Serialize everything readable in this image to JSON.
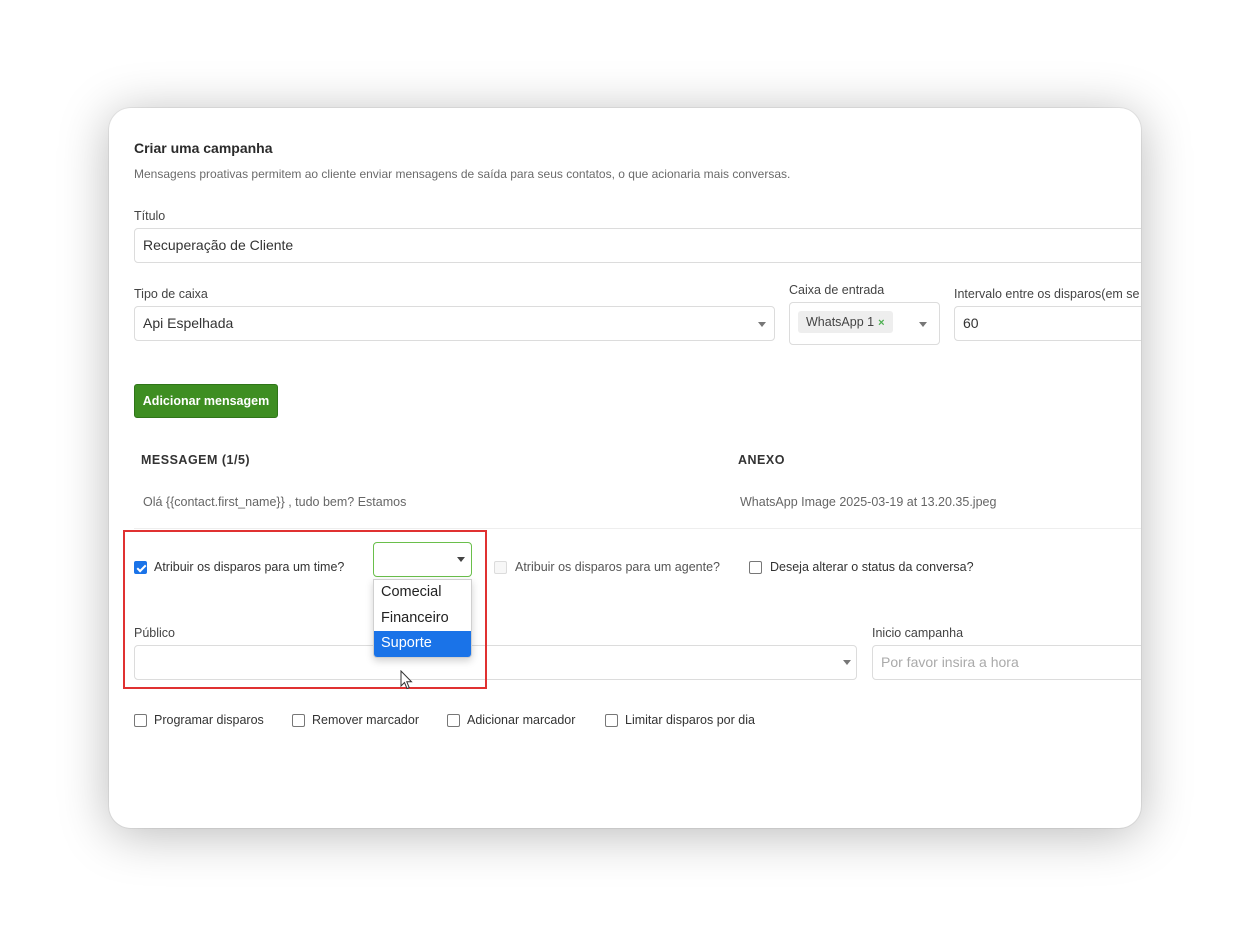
{
  "header": {
    "title": "Criar uma campanha",
    "subtitle": "Mensagens proativas permitem ao cliente enviar mensagens de saída para seus contatos, o que acionaria mais conversas."
  },
  "form": {
    "titulo": {
      "label": "Título",
      "value": "Recuperação de Cliente"
    },
    "tipo_caixa": {
      "label": "Tipo de caixa",
      "value": "Api Espelhada"
    },
    "caixa_entrada": {
      "label": "Caixa de entrada",
      "chip": "WhatsApp 1",
      "chip_remove": "×"
    },
    "intervalo": {
      "label": "Intervalo entre os disparos(em se",
      "value": "60"
    },
    "add_message_button": "Adicionar mensagem"
  },
  "messages_table": {
    "col_message": "MESSAGEM (1/5)",
    "col_attachment": "ANEXO",
    "rows": [
      {
        "message": "Olá {{contact.first_name}} , tudo bem? Estamos",
        "attachment": "WhatsApp Image 2025-03-19 at 13.20.35.jpeg"
      }
    ]
  },
  "assign": {
    "team_checkbox": {
      "label": "Atribuir os disparos para um time?",
      "checked": true
    },
    "team_select": {
      "value": "",
      "options": [
        "Comecial",
        "Financeiro",
        "Suporte"
      ],
      "highlighted": "Suporte"
    },
    "agent_checkbox": {
      "label": "Atribuir os disparos para um agente?",
      "checked": false,
      "disabled": true
    },
    "status_checkbox": {
      "label": "Deseja alterar o status da conversa?",
      "checked": false
    }
  },
  "publico": {
    "label": "Público",
    "value": ""
  },
  "inicio": {
    "label": "Inicio campanha",
    "placeholder": "Por favor insira a hora"
  },
  "options": [
    {
      "label": "Programar disparos",
      "checked": false
    },
    {
      "label": "Remover marcador",
      "checked": false
    },
    {
      "label": "Adicionar marcador",
      "checked": false
    },
    {
      "label": "Limitar disparos por dia",
      "checked": false
    }
  ],
  "colors": {
    "primary_button": "#3e8e22",
    "checkbox_checked": "#1a73e8",
    "dropdown_selected": "#1a73e8",
    "select_focus_border": "#6abf4b",
    "annotation_border": "#e03131"
  }
}
